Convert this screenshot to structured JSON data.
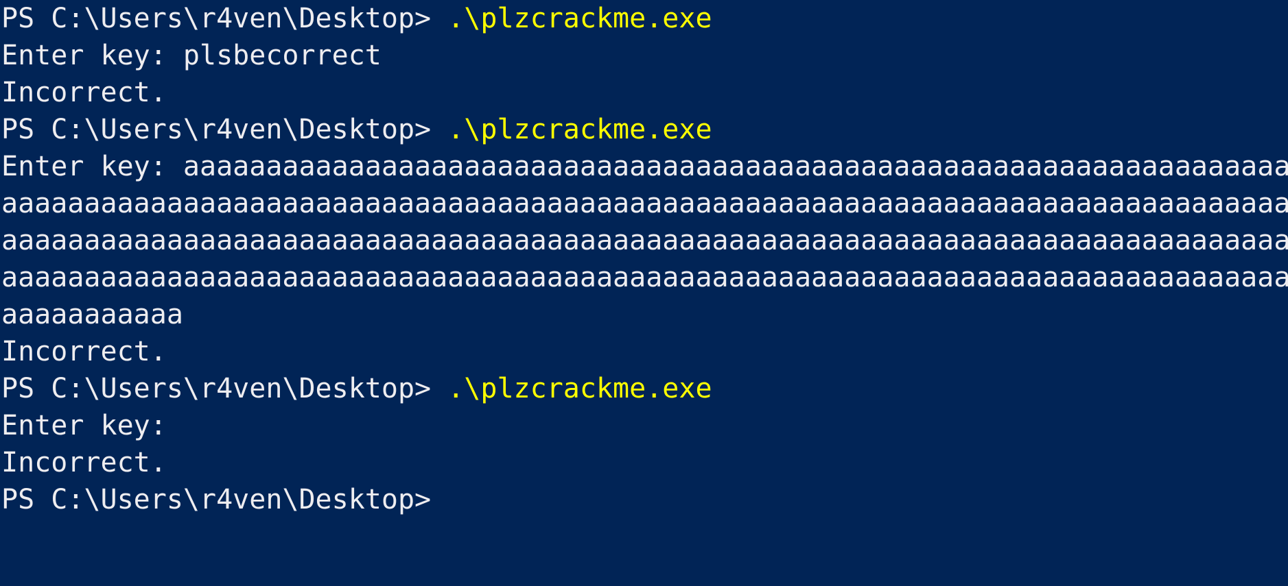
{
  "terminal": {
    "colors": {
      "background": "#012456",
      "text": "#eeedf0",
      "command": "#ffff00"
    },
    "lines": [
      {
        "prompt": "PS C:\\Users\\r4ven\\Desktop> ",
        "command": ".\\plzcrackme.exe"
      },
      {
        "text": "Enter key: plsbecorrect"
      },
      {
        "text": "Incorrect."
      },
      {
        "prompt": "PS C:\\Users\\r4ven\\Desktop> ",
        "command": ".\\plzcrackme.exe"
      },
      {
        "text": "Enter key: aaaaaaaaaaaaaaaaaaaaaaaaaaaaaaaaaaaaaaaaaaaaaaaaaaaaaaaaaaaaaaaaaaaaaaaaaaaaa"
      },
      {
        "text": "aaaaaaaaaaaaaaaaaaaaaaaaaaaaaaaaaaaaaaaaaaaaaaaaaaaaaaaaaaaaaaaaaaaaaaaaaaaaaaaaaaaaaaaaaa"
      },
      {
        "text": "aaaaaaaaaaaaaaaaaaaaaaaaaaaaaaaaaaaaaaaaaaaaaaaaaaaaaaaaaaaaaaaaaaaaaaaaaaaaaaaaaaaaaaaaaa"
      },
      {
        "text": "aaaaaaaaaaaaaaaaaaaaaaaaaaaaaaaaaaaaaaaaaaaaaaaaaaaaaaaaaaaaaaaaaaaaaaaaaaaaaaaaaaaaaaaaaa"
      },
      {
        "text": "aaaaaaaaaaa"
      },
      {
        "text": "Incorrect."
      },
      {
        "prompt": "PS C:\\Users\\r4ven\\Desktop> ",
        "command": ".\\plzcrackme.exe"
      },
      {
        "text": "Enter key:"
      },
      {
        "text": "Incorrect."
      },
      {
        "prompt": "PS C:\\Users\\r4ven\\Desktop> ",
        "command": ""
      }
    ]
  }
}
